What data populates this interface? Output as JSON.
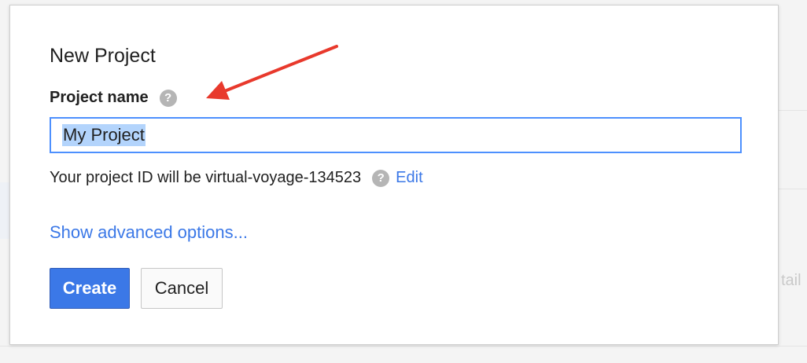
{
  "background": {
    "partial_text": "tail"
  },
  "dialog": {
    "title": "New Project",
    "field_label": "Project name",
    "help_glyph": "?",
    "input_value": "My Project",
    "project_id_text": "Your project ID will be virtual-voyage-134523",
    "edit_link": "Edit",
    "advanced_link": "Show advanced options...",
    "create_label": "Create",
    "cancel_label": "Cancel"
  },
  "colors": {
    "accent": "#3b78e7",
    "input_focus": "#4d90fe",
    "selection": "#b3d4fc",
    "annotation_arrow": "#e8392c"
  },
  "icons": {
    "help": "help-icon",
    "annotation": "red-arrow-annotation"
  }
}
